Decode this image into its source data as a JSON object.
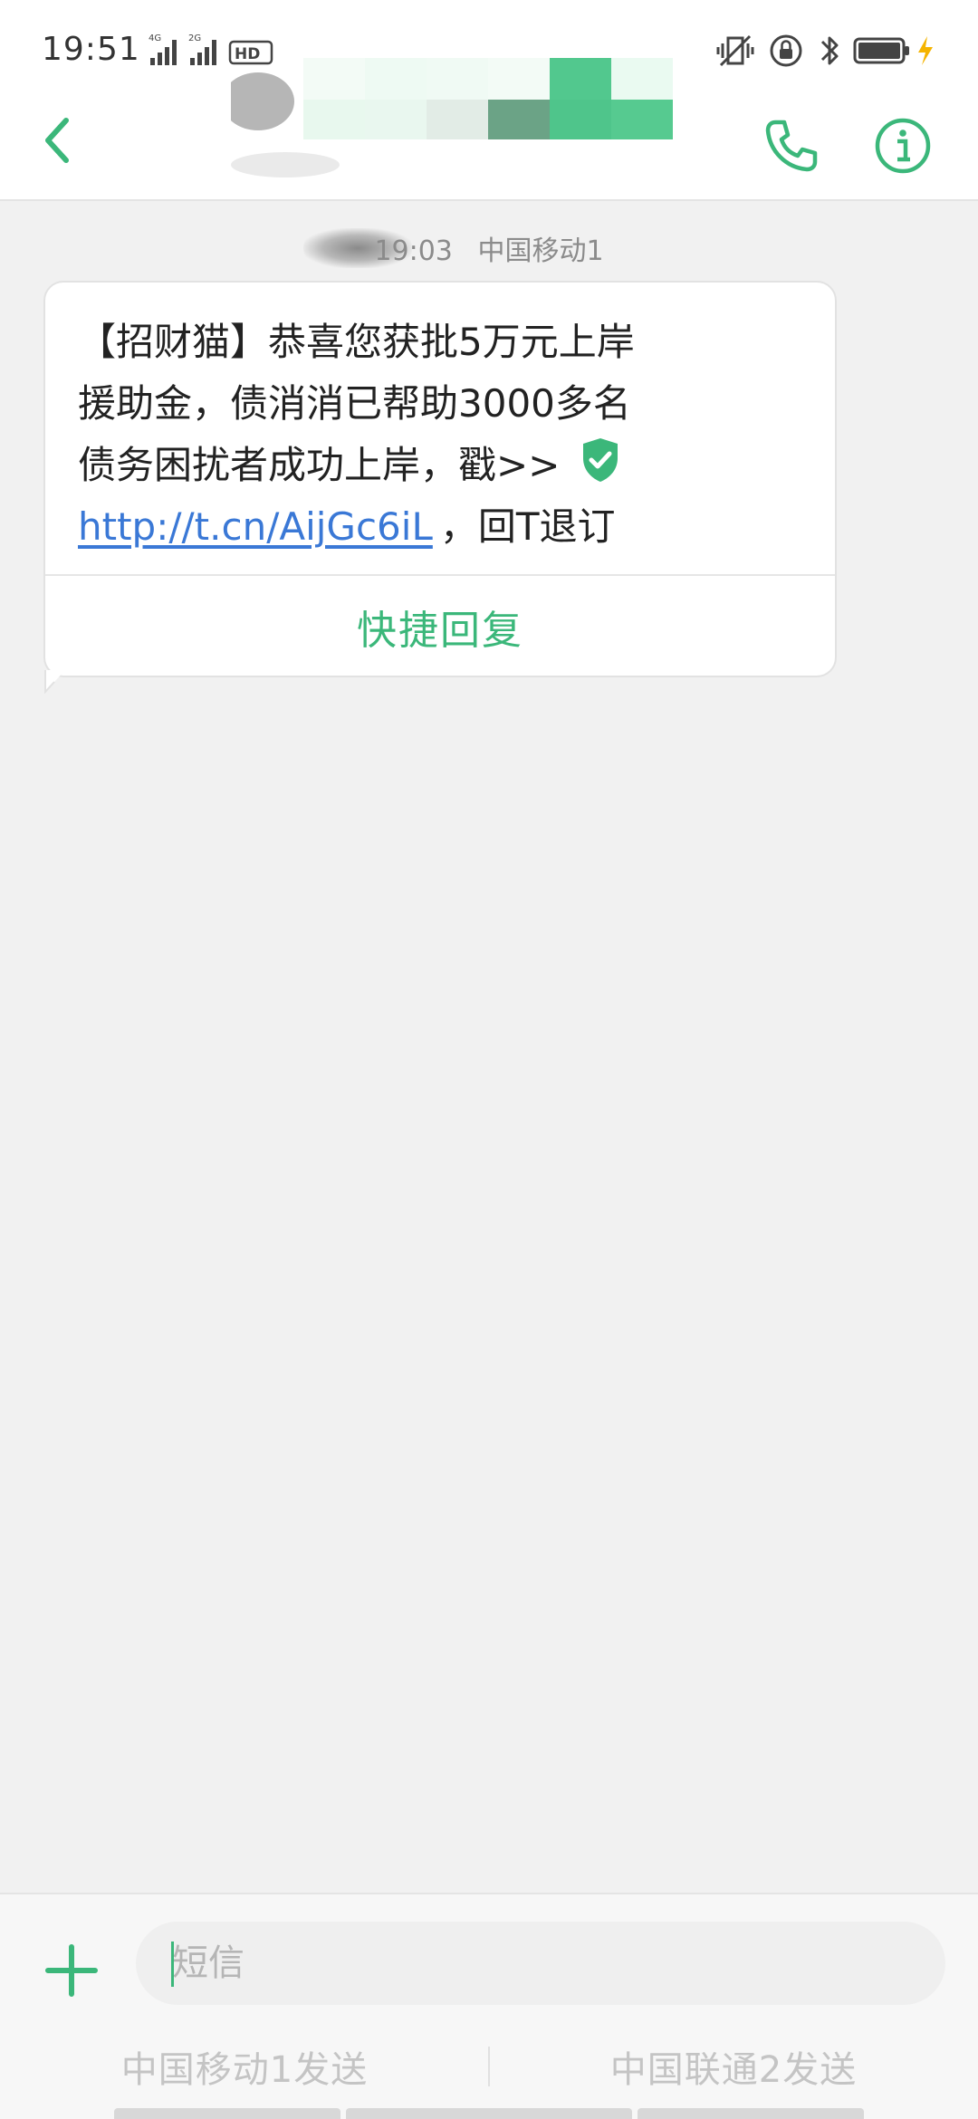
{
  "status_bar": {
    "time": "19:51",
    "network_labels": [
      "4G",
      "2G",
      "HD"
    ],
    "icons": [
      "vibrate-icon",
      "rotation-lock-icon",
      "bluetooth-icon",
      "battery-icon",
      "charging-icon"
    ]
  },
  "header": {
    "contact_name": "",
    "icons": [
      "back-chevron-icon",
      "phone-icon",
      "info-icon"
    ]
  },
  "thread": {
    "timestamp_time": "19:03",
    "timestamp_sim": "中国移动1",
    "message": {
      "lines": [
        "【招财猫】恭喜您获批5万元上岸",
        "援助金，债消消已帮助3000多名",
        "债务困扰者成功上岸，戳>>"
      ],
      "link": "http://t.cn/AijGc6iL",
      "suffix": "，回T退订",
      "verified_icon": "shield-check-icon"
    },
    "quick_reply_label": "快捷回复"
  },
  "composer": {
    "input_placeholder": "短信",
    "input_value": "",
    "send_sim1_label": "中国移动1发送",
    "send_sim2_label": "中国联通2发送"
  },
  "colors": {
    "accent": "#3bb77a",
    "link": "#3a78d6",
    "background": "#f1f1f1",
    "bubble": "#ffffff"
  }
}
